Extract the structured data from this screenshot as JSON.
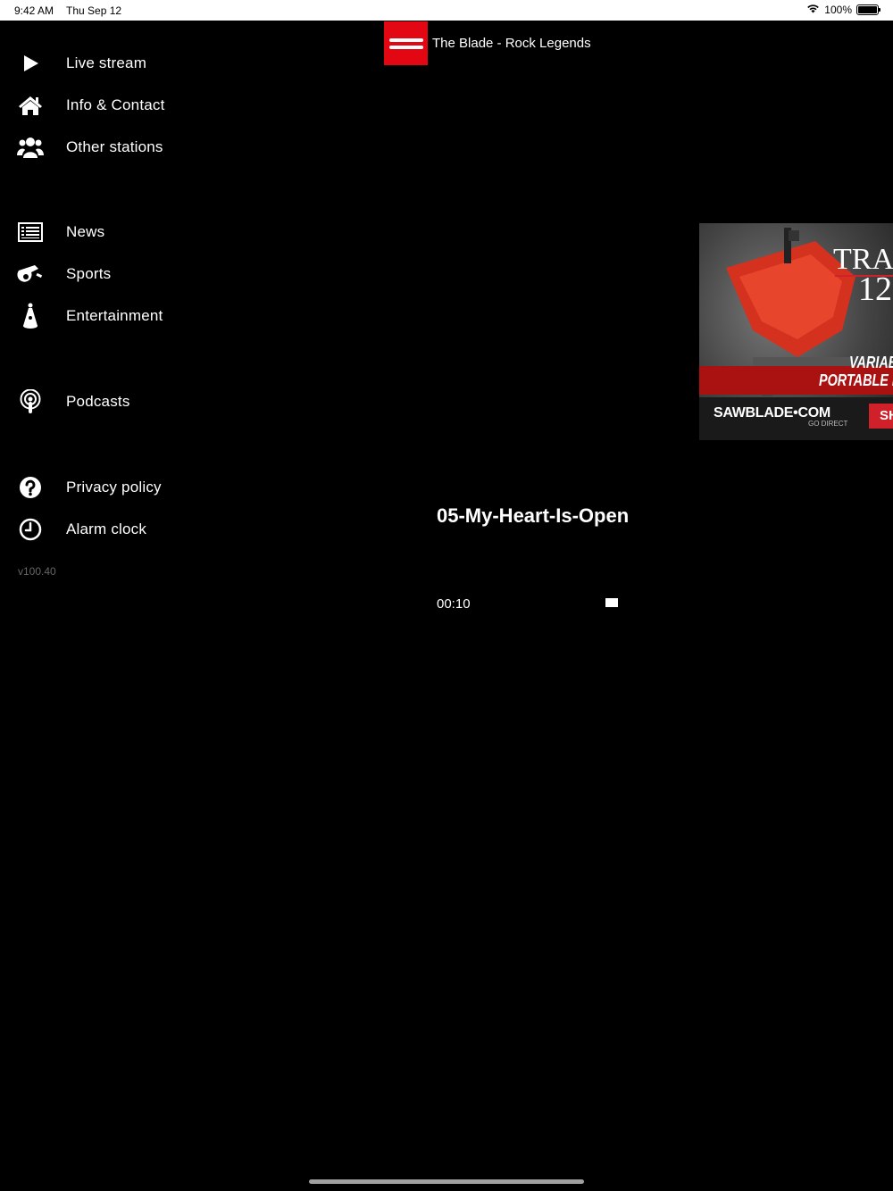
{
  "status_bar": {
    "time": "9:42 AM",
    "date": "Thu Sep 12",
    "battery": "100%",
    "battery_level": 1.0
  },
  "header": {
    "station_title": "The Blade - Rock Legends"
  },
  "sidebar": {
    "items": [
      {
        "label": "Live stream",
        "icon": "play-icon"
      },
      {
        "label": "Info & Contact",
        "icon": "home-icon"
      },
      {
        "label": "Other stations",
        "icon": "users-icon"
      },
      {
        "label": "News",
        "icon": "newspaper-icon"
      },
      {
        "label": "Sports",
        "icon": "whistle-icon"
      },
      {
        "label": "Entertainment",
        "icon": "spotlight-icon"
      },
      {
        "label": "Podcasts",
        "icon": "podcast-icon"
      },
      {
        "label": "Privacy policy",
        "icon": "question-icon"
      },
      {
        "label": "Alarm clock",
        "icon": "clock-icon"
      }
    ],
    "version": "v100.40"
  },
  "ad": {
    "headline_1": "TRA",
    "headline_2": "12",
    "tagline_1": "VARIAB",
    "tagline_2": "PORTABLE BA",
    "brand": "SAWBLADE•COM",
    "brand_sub": "GO DIRECT",
    "cta": "SH"
  },
  "player": {
    "track_title": "05-My-Heart-Is-Open",
    "elapsed": "00:10"
  },
  "colors": {
    "accent": "#e30613",
    "background": "#000000",
    "text": "#ffffff"
  }
}
